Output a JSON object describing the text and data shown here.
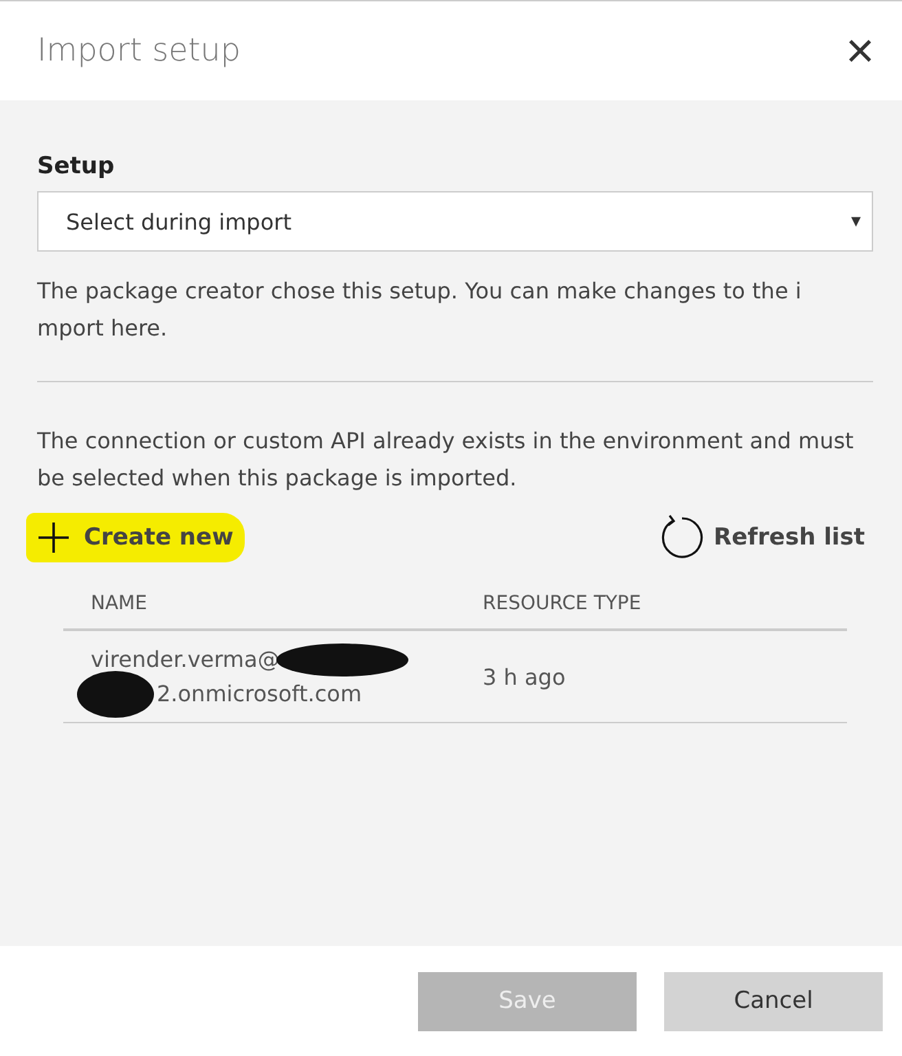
{
  "dialog": {
    "title": "Import setup",
    "close": "×"
  },
  "setup": {
    "label": "Setup",
    "value": "Select during import",
    "caret": "▾",
    "help": "The package creator chose this setup. You can make changes to the i mport here."
  },
  "connection": {
    "description": "The connection or custom API already exists in the environment and must be selected when this package is imported.",
    "create_button": {
      "label": "Create new",
      "highlighted": true
    },
    "refresh_button": {
      "label": "Refresh list"
    }
  },
  "table": {
    "columns": [
      "NAME",
      "RESOURCE TYPE"
    ],
    "rows": [
      {
        "name_lines": [
          "virender.verma@",
          "2.onmicrosoft.com"
        ],
        "resource_type": "3 h ago"
      }
    ]
  },
  "buttons": [
    {
      "label": "Save",
      "disabled": true
    },
    {
      "label": "Cancel",
      "disabled": false
    }
  ]
}
